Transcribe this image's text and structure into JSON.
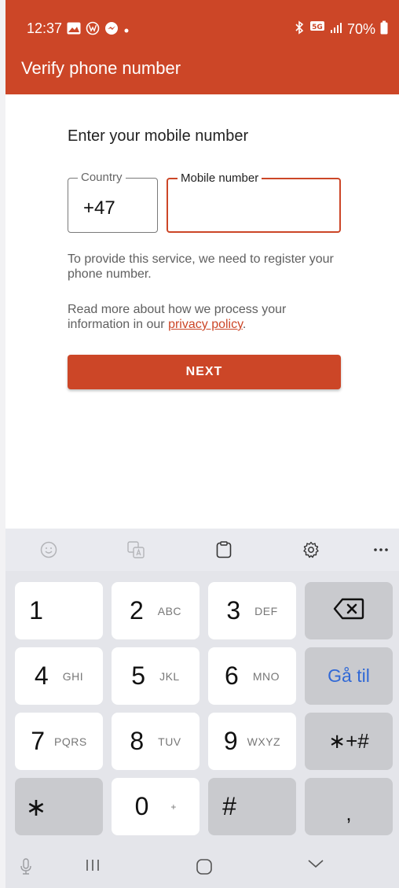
{
  "status_bar": {
    "time": "12:37",
    "battery": "70%",
    "network_badge": "5G",
    "icons_left": [
      "gallery-icon",
      "vw-icon",
      "messenger-icon",
      "dot-icon"
    ],
    "icons_right": [
      "bluetooth-icon",
      "5g-icon",
      "signal-icon",
      "battery-icon"
    ]
  },
  "app_bar": {
    "title": "Verify phone number"
  },
  "form": {
    "heading": "Enter your mobile number",
    "country_label": "Country",
    "country_value": "+47",
    "mobile_label": "Mobile number",
    "mobile_value": "",
    "info_text": "To provide this service, we need to register your phone number.",
    "privacy_prefix": "Read more about how we process your information in our ",
    "privacy_link": "privacy policy",
    "privacy_suffix": ".",
    "next_button": "NEXT"
  },
  "keyboard": {
    "toolbar": [
      "emoji-icon",
      "translate-icon",
      "clipboard-icon",
      "settings-icon",
      "more-icon"
    ],
    "keys": [
      {
        "digit": "1",
        "letters": ""
      },
      {
        "digit": "2",
        "letters": "ABC"
      },
      {
        "digit": "3",
        "letters": "DEF"
      },
      {
        "digit": "4",
        "letters": "GHI"
      },
      {
        "digit": "5",
        "letters": "JKL"
      },
      {
        "digit": "6",
        "letters": "MNO"
      },
      {
        "digit": "7",
        "letters": "PQRS"
      },
      {
        "digit": "8",
        "letters": "TUV"
      },
      {
        "digit": "9",
        "letters": "WXYZ"
      },
      {
        "digit": "∗",
        "letters": ""
      },
      {
        "digit": "0",
        "letters": "+"
      },
      {
        "digit": "#",
        "letters": ""
      }
    ],
    "go_label": "Gå til",
    "symbols_label": "∗+#",
    "comma_label": ","
  },
  "navigation": [
    "microphone-icon",
    "recent-apps-icon",
    "home-icon",
    "hide-keyboard-icon"
  ],
  "colors": {
    "accent": "#cc4627",
    "go_text": "#3169d6"
  }
}
